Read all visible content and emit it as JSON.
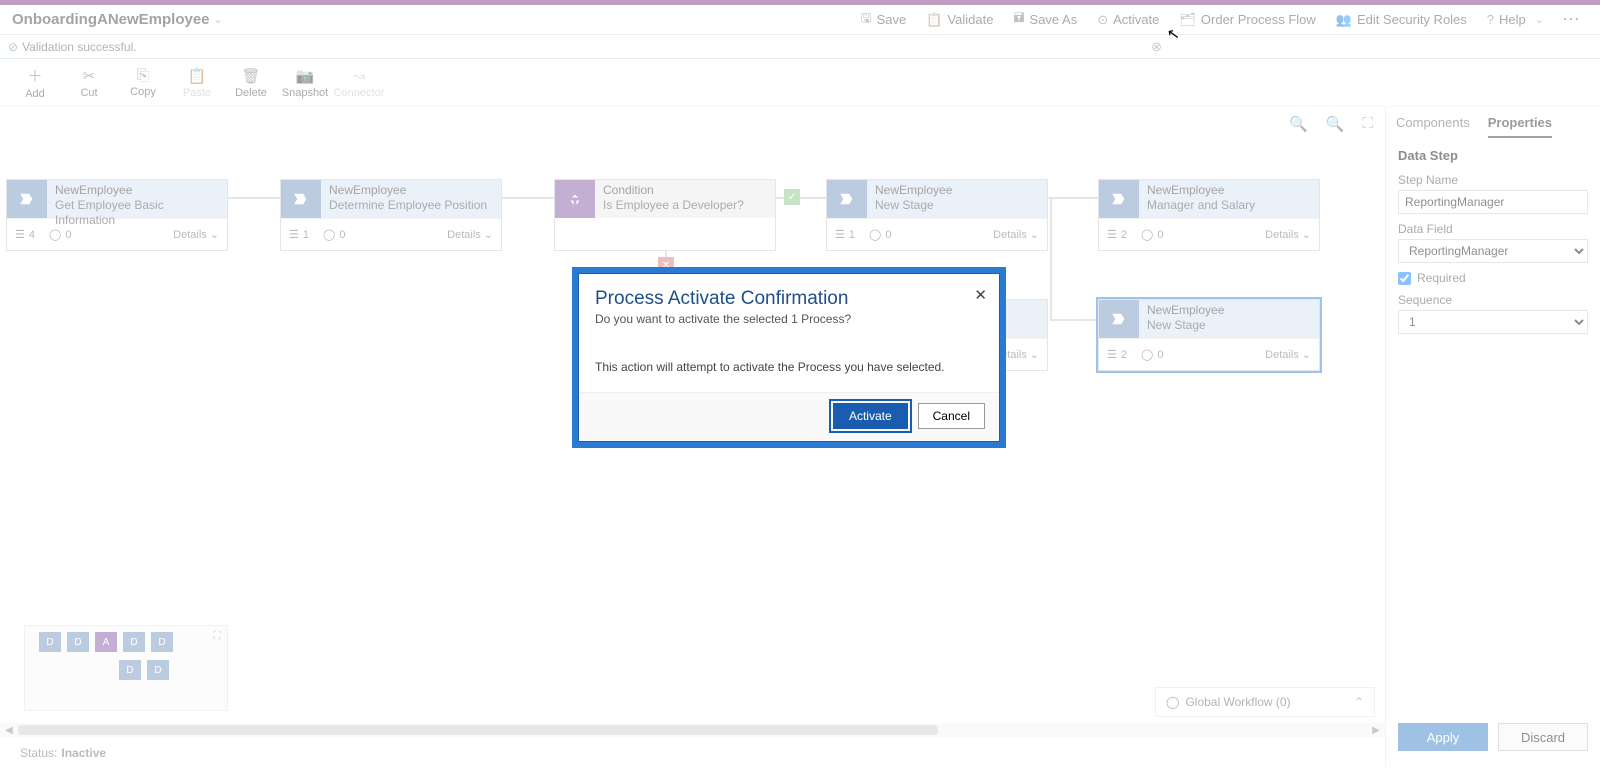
{
  "header": {
    "title": "OnboardingANewEmployee",
    "buttons": {
      "save": "Save",
      "validate": "Validate",
      "saveAs": "Save As",
      "activate": "Activate",
      "order": "Order Process Flow",
      "security": "Edit Security Roles",
      "help": "Help"
    }
  },
  "validation": {
    "message": "Validation successful."
  },
  "toolbar": {
    "add": "Add",
    "cut": "Cut",
    "copy": "Copy",
    "paste": "Paste",
    "delete": "Delete",
    "snapshot": "Snapshot",
    "connector": "Connector"
  },
  "stages": {
    "s1": {
      "entity": "NewEmployee",
      "name": "Get Employee Basic Information",
      "m1": "4",
      "m2": "0",
      "details": "Details"
    },
    "s2": {
      "entity": "NewEmployee",
      "name": "Determine Employee Position",
      "m1": "1",
      "m2": "0",
      "details": "Details"
    },
    "s3": {
      "entity": "Condition",
      "name": "Is Employee a Developer?",
      "details": ""
    },
    "s4": {
      "entity": "NewEmployee",
      "name": "New Stage",
      "m1": "1",
      "m2": "0",
      "details": "Details"
    },
    "s5": {
      "entity": "NewEmployee",
      "name": "Manager and Salary",
      "m1": "2",
      "m2": "0",
      "details": "Details"
    },
    "s7": {
      "entity": "NewEmployee",
      "name": "New Stage",
      "m1": "2",
      "m2": "0",
      "details": "Details"
    }
  },
  "minimap": {
    "d": "D",
    "a": "A"
  },
  "globalWf": {
    "label": "Global Workflow (0)"
  },
  "status": {
    "label": "Status:",
    "value": "Inactive"
  },
  "rpane": {
    "tabs": {
      "components": "Components",
      "properties": "Properties"
    },
    "title": "Data Step",
    "stepNameLabel": "Step Name",
    "stepName": "ReportingManager",
    "dataFieldLabel": "Data Field",
    "dataField": "ReportingManager",
    "requiredLabel": "Required",
    "sequenceLabel": "Sequence",
    "sequence": "1",
    "apply": "Apply",
    "discard": "Discard"
  },
  "modal": {
    "title": "Process Activate Confirmation",
    "subtitle": "Do you want to activate the selected 1 Process?",
    "body": "This action will attempt to activate the Process you have selected.",
    "activate": "Activate",
    "cancel": "Cancel",
    "close": "✕"
  }
}
